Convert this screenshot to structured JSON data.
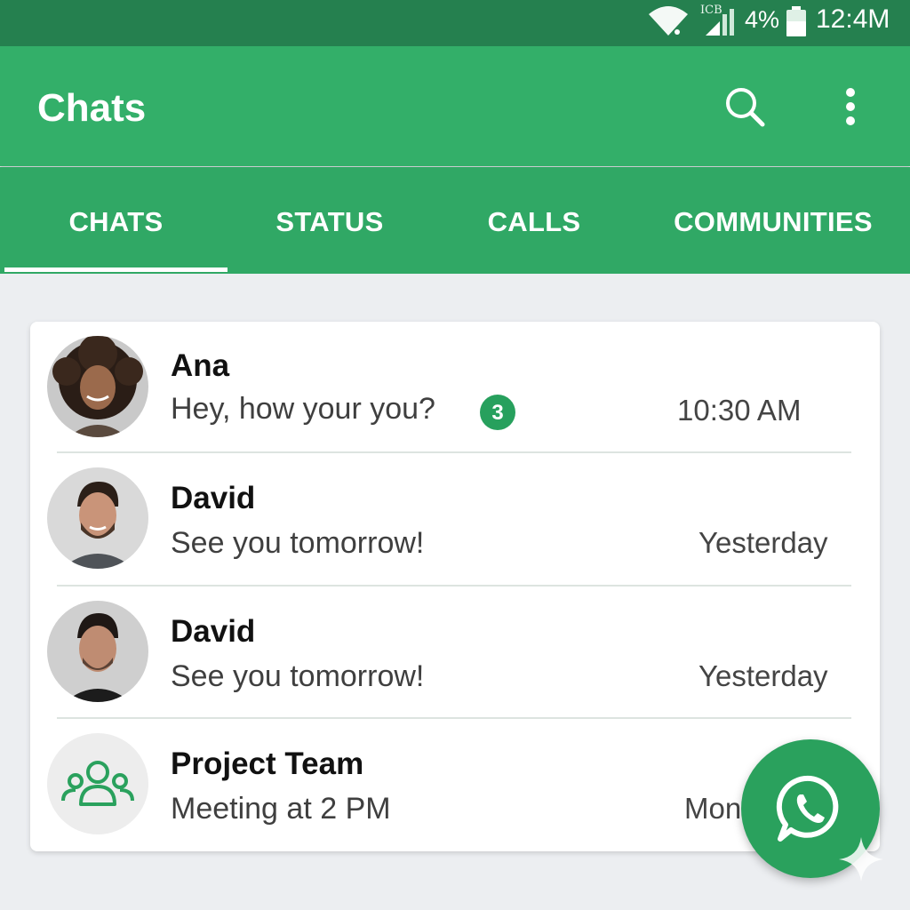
{
  "status_bar": {
    "network_label": "ICB",
    "battery_percent": "4%",
    "time": "12:4M",
    "icons": [
      "wifi-icon",
      "signal-icon",
      "battery-icon"
    ]
  },
  "app_bar": {
    "title": "Chats",
    "icons": [
      "search-icon",
      "more-vert-icon"
    ]
  },
  "tabs": [
    {
      "label": "CHATS",
      "selected": true
    },
    {
      "label": "STATUS",
      "selected": false
    },
    {
      "label": "CALLS",
      "selected": false
    },
    {
      "label": "COMMUNITIES",
      "selected": false
    }
  ],
  "chats": [
    {
      "name": "Ana",
      "preview": "Hey, how your you?",
      "unread": "3",
      "time": "10:30 AM",
      "avatar": "avatar-photo-icon"
    },
    {
      "name": "David",
      "preview": "See you tomorrow!",
      "time": "Yesterday",
      "avatar": "avatar-photo-icon"
    },
    {
      "name": "David",
      "preview": "See you tomorrow!",
      "time": "Yesterday",
      "avatar": "avatar-photo-icon"
    },
    {
      "name": "Project Team",
      "preview": "Meeting at 2 PM",
      "time": "Mon",
      "avatar": "group-icon"
    }
  ],
  "fab": {
    "icon": "whatsapp-chat-icon"
  },
  "colors": {
    "status_bar": "#25804f",
    "app_bar": "#33af69",
    "tab_bar": "#30a865",
    "accent": "#2aa15d",
    "background": "#eceef1"
  }
}
